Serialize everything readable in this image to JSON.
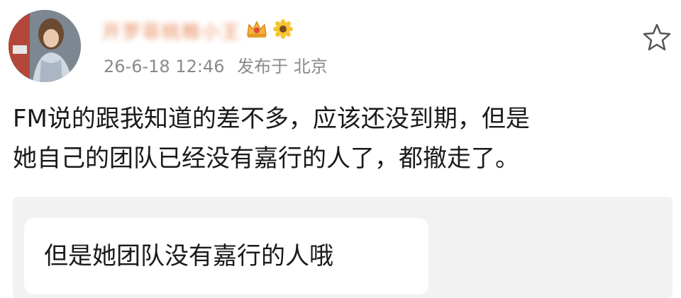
{
  "post": {
    "author": {
      "name": "开罗菲桃粮小王",
      "badges": [
        "crown-badge-icon",
        "sunflower-badge-icon"
      ]
    },
    "timestamp": "26-6-18 12:46",
    "posted_at_label": "发布于",
    "location": "北京",
    "body_lines": [
      "FM说的跟我知道的差不多，应该还没到期，但是",
      "她自己的团队已经没有嘉行的人了，都撤走了。"
    ],
    "quoted_reply": "但是她团队没有嘉行的人哦"
  },
  "icons": {
    "favorite": "star-outline-icon"
  },
  "colors": {
    "text_primary": "#1a1a1a",
    "text_secondary": "#8a8a8a",
    "quote_background": "#f2f2f2",
    "username_blurred": "#e88a5a"
  }
}
